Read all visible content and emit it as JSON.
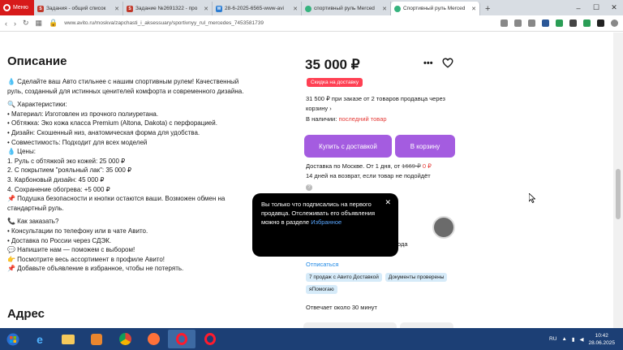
{
  "browser": {
    "menu_label": "Меню",
    "tabs": [
      {
        "label": "Задания - общий список",
        "icon": "sp-favicon",
        "active": false
      },
      {
        "label": "Задание №2691322 - про",
        "icon": "sp-favicon",
        "active": false
      },
      {
        "label": "28-6-2025-6565-www-avi",
        "icon": "doc-favicon",
        "active": false
      },
      {
        "label": "спортивный руль Merced",
        "icon": "avito-favicon",
        "active": false
      },
      {
        "label": "Спортивный руль Merced",
        "icon": "avito-favicon",
        "active": true
      }
    ],
    "url": "www.avito.ru/moskva/zapchasti_i_aksessuary/sportivnyy_rul_mercedes_7453581739"
  },
  "description": {
    "heading": "Описание",
    "lines": [
      "💧 Сделайте ваш Авто стильнее с нашим спортивным рулем! Качественный руль, созданный для истинных ценителей комфорта и современного дизайна.",
      "",
      "🔍 Характеристики:",
      "• Материал: Изготовлен из прочного полиуретана.",
      "• Обтяжка: Эко кожа класса Premium (Altona, Dakota) с перфорацией.",
      "• Дизайн: Скошенный низ, анатомическая форма для удобства.",
      "• Совместимость: Подходит для всех моделей",
      "💧 Цены:",
      "1. Руль с обтяжкой эко кожей: 25 000 ₽",
      "2. С покрытием \"рояльный лак\": 35 000 ₽",
      "3. Карбоновый дизайн: 45 000 ₽",
      "4. Сохранение обогрева: +5 000 ₽",
      "📌 Подушка безопасности и кнопки остаются ваши. Возможен обмен на стандартный руль.",
      "",
      "📞 Как заказать?",
      "• Консультации по телефону или в чате Авито.",
      "• Доставка по России через СДЭК.",
      "💬 Напишите нам — поможем с выбором!",
      "👉 Посмотрите весь ассортимент в профиле Авито!",
      "📌 Добавьте объявление в избранное, чтобы не потерять."
    ]
  },
  "address_heading": "Адрес",
  "offer": {
    "price": "35 000 ₽",
    "discount_badge": "Скидка на доставку",
    "two_items_text": "31 500 ₽ при заказе от 2 товаров продавца через корзину ›",
    "stock_label": "В наличии:",
    "stock_value": "последний товар",
    "buy_button": "Купить с доставкой",
    "cart_button": "В корзину",
    "delivery_prefix": "Доставка по Москве. От 1 дня, от",
    "delivery_old": "1669 ₽",
    "delivery_new": "0 ₽",
    "return_text": "14 дней на возврат, если товар не подойдёт",
    "info_icon": "?"
  },
  "seller": {
    "name_fragment": "И",
    "since_fragment": "ода",
    "unsubscribe": "Отписаться",
    "badges": [
      "7 продаж с Авито Доставкой",
      "Документы проверены",
      "яПомогаю"
    ],
    "response_time": "Отвечает около 30 минут"
  },
  "popup": {
    "text": "Вы только что подписались на первого продавца. Отслеживать его объявления можно в разделе",
    "link": "Избранное",
    "close": "✕"
  },
  "taskbar": {
    "lang": "RU",
    "time": "10:42",
    "date": "28.06.2025"
  },
  "colors": {
    "accent": "#a45ce0",
    "discount": "#ff4053",
    "link": "#1e88e5",
    "tab_bar": "#d8dde3",
    "taskbar": "#1c3f75"
  }
}
